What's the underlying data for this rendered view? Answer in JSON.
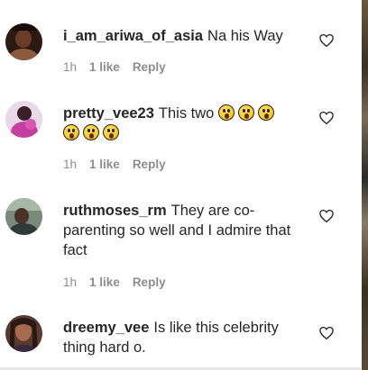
{
  "comments": [
    {
      "username": "i_am_ariwa_of_asia",
      "text": "Na his Way",
      "time": "1h",
      "likes": "1 like",
      "reply": "Reply",
      "emoji_count": 0
    },
    {
      "username": "pretty_vee23",
      "text": "This two",
      "time": "1h",
      "likes": "1 like",
      "reply": "Reply",
      "emoji_icon": "astonished-face-emoji",
      "emoji_count": 6
    },
    {
      "username": "ruthmoses_rm",
      "text": "They are co-parenting so well and I admire that fact",
      "time": "1h",
      "likes": "1 like",
      "reply": "Reply",
      "emoji_count": 0
    },
    {
      "username": "dreemy_vee",
      "text": "Is like this celebrity thing hard o.",
      "emoji_count": 0
    }
  ],
  "icons": {
    "like": "heart-outline-icon"
  },
  "colors": {
    "text": "#262626",
    "meta": "#8e8e8e"
  }
}
